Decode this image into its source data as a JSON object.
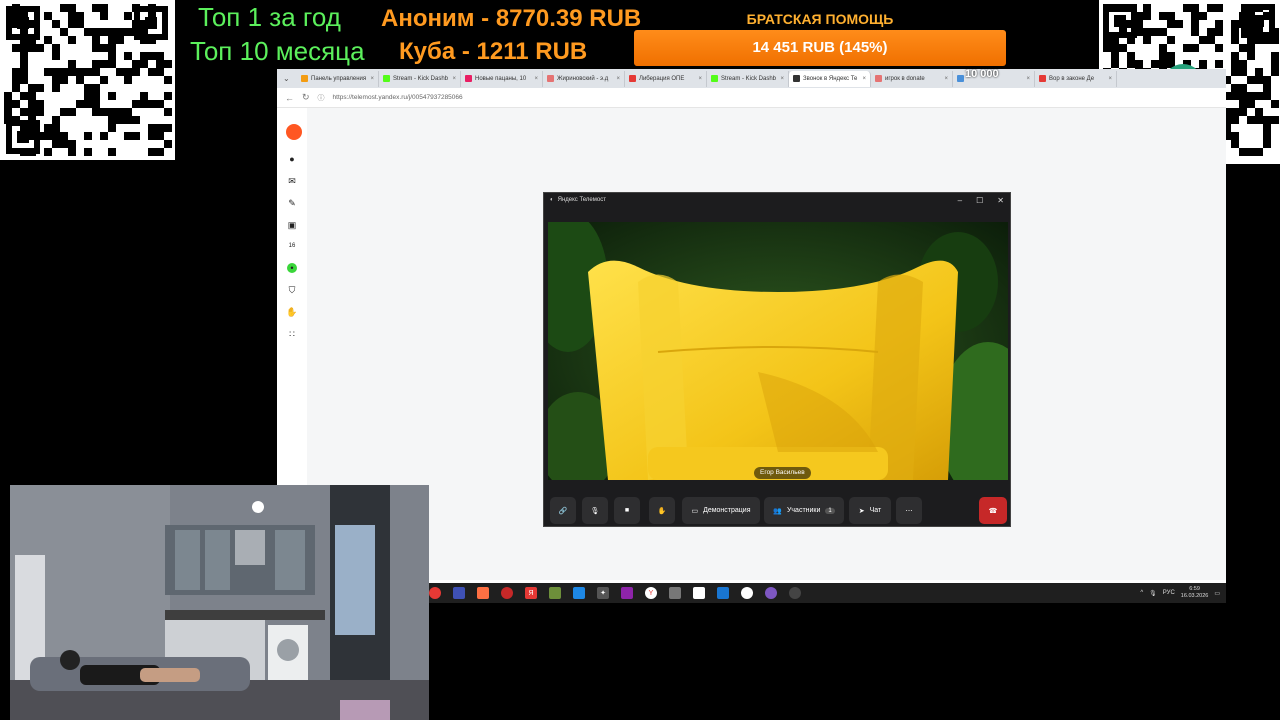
{
  "overlay": {
    "top_year": "Топ 1 за год",
    "top_month": "Топ 10 месяца",
    "donor_1": "Аноним - 8770.39 RUB",
    "donor_2": "Куба - 1211 RUB",
    "help_title": "БРАТСКАЯ ПОМОЩЬ",
    "help_amount": "14 451 RUB (145%)",
    "counter": "10 000"
  },
  "browser": {
    "tabs": [
      {
        "label": "Панель управления",
        "color": "#f39c12"
      },
      {
        "label": "Stream - Kick Dashb",
        "color": "#53fc18"
      },
      {
        "label": "Новые пацаны, 10",
        "color": "#e91e63"
      },
      {
        "label": "Жириновский - э.д",
        "color": "#e57373"
      },
      {
        "label": "Либерация ОПЕ",
        "color": "#e53935"
      },
      {
        "label": "Stream - Kick Dashb",
        "color": "#53fc18"
      },
      {
        "label": "Звонок в Яндекс Те",
        "color": "#333333"
      },
      {
        "label": "игрок в donate",
        "color": "#e57373"
      },
      {
        "label": "",
        "color": "#4a90d9"
      },
      {
        "label": "Вор в законе Де",
        "color": "#e53935"
      }
    ],
    "url": "https://telemost.yandex.ru/j/00547937285066"
  },
  "telemost": {
    "window_title": "Яндекс Телемост",
    "participant_name": "Егор Васильев",
    "btn_demo": "Демонстрация",
    "btn_participants": "Участники",
    "participants_count": "1",
    "btn_chat": "Чат"
  },
  "taskbar": {
    "lang": "РУС",
    "time": "6:59",
    "date": "16.03.2026"
  },
  "colors": {
    "help_bar": "#f07d0a",
    "green_text": "#5cf05c",
    "orange_text": "#ff9a20",
    "end_call": "#c62828"
  }
}
